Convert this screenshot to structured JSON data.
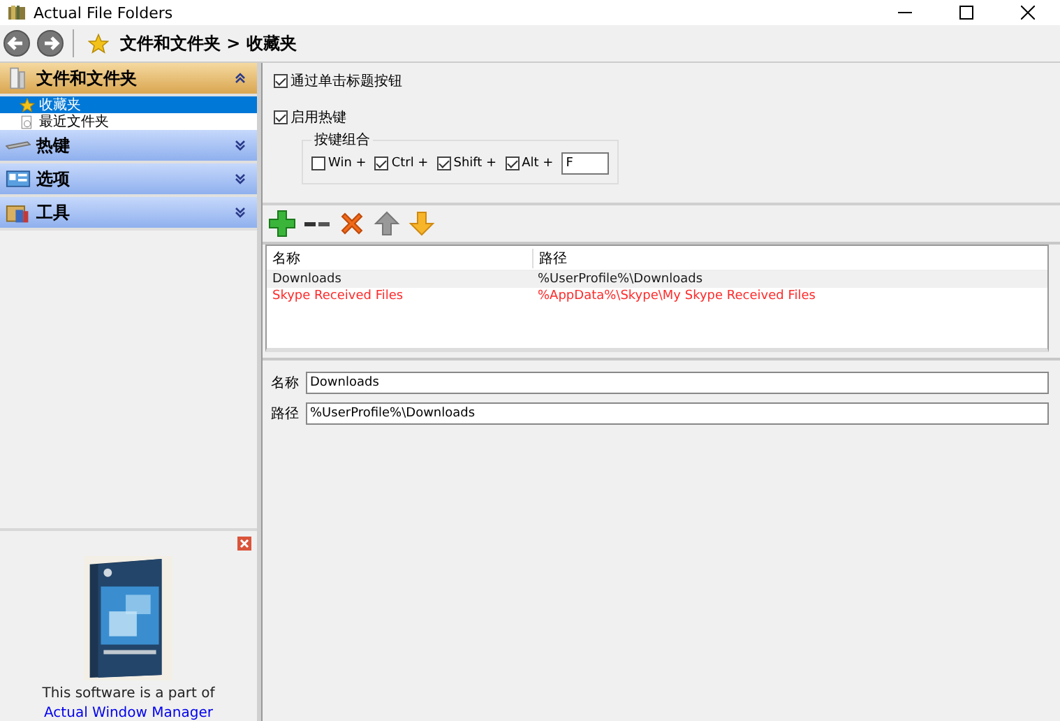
{
  "window": {
    "title": "Actual File Folders"
  },
  "toolbar": {
    "breadcrumb": "文件和文件夹 > 收藏夹"
  },
  "sidebar": {
    "sections": [
      {
        "label": "文件和文件夹",
        "kind": "folders",
        "expanded": true,
        "children": [
          {
            "label": "收藏夹",
            "kind": "star",
            "selected": true
          },
          {
            "label": "最近文件夹",
            "kind": "recent",
            "selected": false
          }
        ]
      },
      {
        "label": "热键",
        "kind": "keyboard",
        "expanded": false
      },
      {
        "label": "选项",
        "kind": "options",
        "expanded": false
      },
      {
        "label": "工具",
        "kind": "tools",
        "expanded": false
      }
    ]
  },
  "ad": {
    "text": "This software is a part of",
    "link": "Actual Window Manager"
  },
  "options": {
    "click_title": {
      "label": "通过单击标题按钮",
      "checked": true
    },
    "hotkey": {
      "label": "启用热键",
      "checked": true
    },
    "combo": {
      "legend": "按键组合",
      "modifiers": [
        {
          "label": "Win +",
          "checked": false
        },
        {
          "label": "Ctrl +",
          "checked": true
        },
        {
          "label": "Shift +",
          "checked": true
        },
        {
          "label": "Alt +",
          "checked": true
        }
      ],
      "key": "F"
    }
  },
  "table": {
    "columns": [
      "名称",
      "路径"
    ],
    "rows": [
      {
        "cells": [
          "Downloads",
          "%UserProfile%\\Downloads"
        ],
        "selected": true,
        "color": "#1a1a1a"
      },
      {
        "cells": [
          "Skype Received Files",
          "%AppData%\\Skype\\My Skype Received Files"
        ],
        "selected": false,
        "color": "#ff2a2a"
      }
    ]
  },
  "editor": {
    "fields": [
      {
        "label": "名称",
        "value": "Downloads"
      },
      {
        "label": "路径",
        "value": "%UserProfile%\\Downloads"
      }
    ]
  }
}
